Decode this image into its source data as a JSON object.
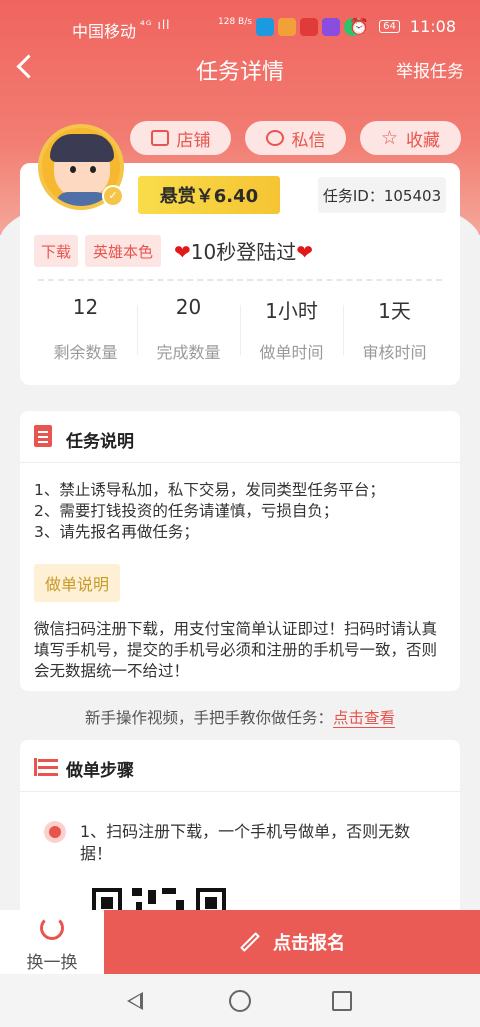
{
  "status_bar": {
    "carrier": "中国移动",
    "signal": "⁴ᴳ ıll",
    "data_rate": "128 B/s",
    "battery": "64",
    "time": "11:08"
  },
  "nav": {
    "title": "任务详情",
    "report": "举报任务"
  },
  "actions": {
    "shop": "店铺",
    "message": "私信",
    "favorite": "收藏"
  },
  "task": {
    "reward": "悬赏￥6.40",
    "task_id": "任务ID：105403",
    "tags": [
      "下载",
      "英雄本色"
    ],
    "title": "10秒登陆过",
    "title_emoji": "❤"
  },
  "stats": [
    {
      "value": "12",
      "label": "剩余数量"
    },
    {
      "value": "20",
      "label": "完成数量"
    },
    {
      "value": "1小时",
      "label": "做单时间"
    },
    {
      "value": "1天",
      "label": "审核时间"
    }
  ],
  "description": {
    "heading": "任务说明",
    "lines": [
      "1、禁止诱导私加，私下交易，发同类型任务平台；",
      "2、需要打钱投资的任务请谨慎，亏损自负；",
      "3、请先报名再做任务；"
    ],
    "note_tag": "做单说明",
    "note": "微信扫码注册下载，用支付宝简单认证即过！扫码时请认真填写手机号，提交的手机号必须和注册的手机号一致，否则会无数据统一不给过！"
  },
  "hint": {
    "text": "新手操作视频，手把手教你做任务：",
    "link": "点击查看"
  },
  "steps": {
    "heading": "做单步骤",
    "items": [
      "1、扫码注册下载，一个手机号做单，否则无数据！"
    ]
  },
  "bottom": {
    "swap": "换一换",
    "signup": "点击报名"
  },
  "colors": {
    "brand": "#ea5b55",
    "gold": "#f7d040"
  }
}
